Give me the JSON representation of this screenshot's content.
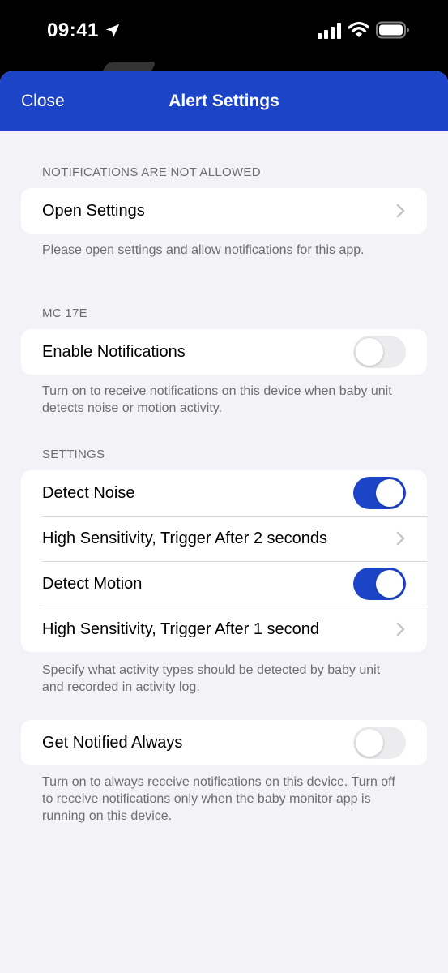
{
  "status_bar": {
    "time": "09:41"
  },
  "nav": {
    "close_label": "Close",
    "title": "Alert Settings"
  },
  "sections": {
    "notifications": {
      "header": "NOTIFICATIONS ARE NOT ALLOWED",
      "open_settings_label": "Open Settings",
      "footer": "Please open settings and allow notifications for this app."
    },
    "device": {
      "header": "MC 17E",
      "enable_label": "Enable Notifications",
      "enable_on": false,
      "footer": "Turn on to receive notifications on this device when baby unit detects noise or motion activity."
    },
    "settings": {
      "header": "SETTINGS",
      "detect_noise_label": "Detect Noise",
      "detect_noise_on": true,
      "noise_sensitivity_label": "High Sensitivity, Trigger After 2 seconds",
      "detect_motion_label": "Detect Motion",
      "detect_motion_on": true,
      "motion_sensitivity_label": "High Sensitivity, Trigger After 1 second",
      "footer": "Specify what activity types should be detected by baby unit and recorded in activity log."
    },
    "always": {
      "label": "Get Notified Always",
      "on": false,
      "footer": "Turn on to always receive notifications on this device. Turn off to receive notifications only when the baby monitor app is running on this device."
    }
  },
  "colors": {
    "accent": "#1c44c7",
    "background": "#f2f2f7",
    "secondary_text": "#6d6d72"
  }
}
